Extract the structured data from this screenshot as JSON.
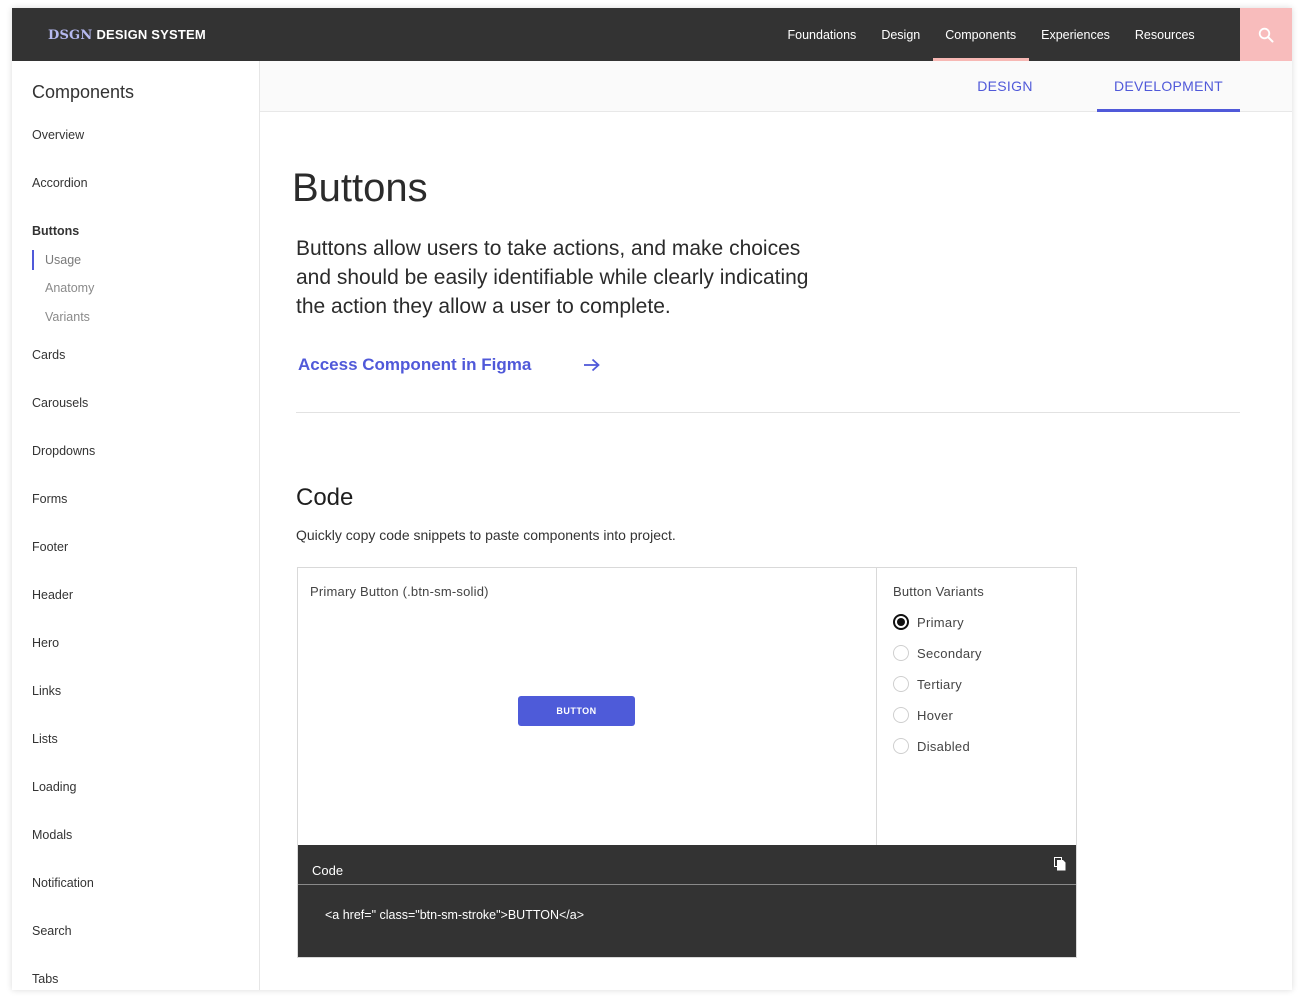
{
  "header": {
    "logo_mark": "DSGN",
    "logo_text": "DESIGN SYSTEM",
    "nav": [
      "Foundations",
      "Design",
      "Components",
      "Experiences",
      "Resources"
    ],
    "active_nav": "Components",
    "accent_color": "#f8bcbc"
  },
  "sidebar": {
    "title": "Components",
    "items": {
      "overview": "Overview",
      "accordion": "Accordion",
      "buttons": "Buttons",
      "buttons_usage": "Usage",
      "buttons_anatomy": "Anatomy",
      "buttons_variants": "Variants",
      "cards": "Cards",
      "carousels": "Carousels",
      "dropdowns": "Dropdowns",
      "forms": "Forms",
      "footer": "Footer",
      "header": "Header",
      "hero": "Hero",
      "links": "Links",
      "lists": "Lists",
      "loading": "Loading",
      "modals": "Modals",
      "notification": "Notification",
      "search": "Search",
      "tabs": "Tabs"
    }
  },
  "tabs": {
    "design": "DESIGN",
    "development": "DEVELOPMENT",
    "active": "DEVELOPMENT"
  },
  "main": {
    "title": "Buttons",
    "intro": "Buttons allow users to take actions, and make choices and should be easily identifiable while clearly indicating the action they allow a user to complete.",
    "figma_link": "Access Component in Figma",
    "code_title": "Code",
    "code_desc": "Quickly copy code snippets to paste components into project.",
    "brand_color": "#5059d9"
  },
  "demo": {
    "preview_label": "Primary Button (.btn-sm-solid)",
    "button_label": "BUTTON",
    "variants_title": "Button Variants",
    "variants": [
      "Primary",
      "Secondary",
      "Tertiary",
      "Hover",
      "Disabled"
    ],
    "selected_variant": "Primary",
    "code_label": "Code",
    "code_snippet": "<a href=\" class=\"btn-sm-stroke\">BUTTON</a>"
  }
}
